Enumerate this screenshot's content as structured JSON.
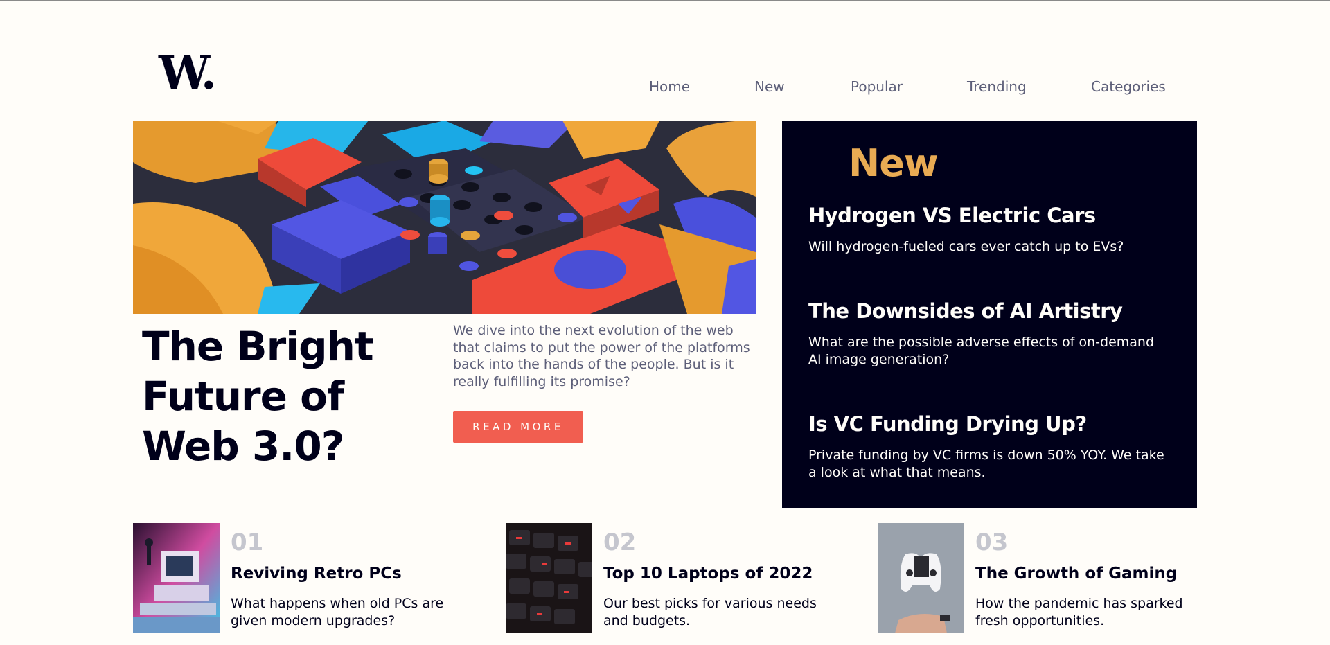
{
  "brand": {
    "logo_text": "W."
  },
  "nav": {
    "items": [
      {
        "label": "Home"
      },
      {
        "label": "New"
      },
      {
        "label": "Popular"
      },
      {
        "label": "Trending"
      },
      {
        "label": "Categories"
      }
    ]
  },
  "hero": {
    "title": "The Bright Future of Web 3.0?",
    "description": "We dive into the next evolution of the web that claims to put the power of the platforms back into the hands of the people. But is it really fulfilling its promise?",
    "button_label": "READ MORE"
  },
  "new_section": {
    "heading": "New",
    "items": [
      {
        "title": "Hydrogen VS Electric Cars",
        "description": "Will hydrogen-fueled cars ever catch up to EVs?"
      },
      {
        "title": "The Downsides of AI Artistry",
        "description": "What are the possible adverse effects of on-demand AI image generation?"
      },
      {
        "title": "Is VC Funding Drying Up?",
        "description": "Private funding by VC firms is down 50% YOY. We take a look at what that means."
      }
    ]
  },
  "cards": [
    {
      "number": "01",
      "title": "Reviving Retro PCs",
      "description": "What happens when old PCs are given modern upgrades?"
    },
    {
      "number": "02",
      "title": "Top 10 Laptops of 2022",
      "description": "Our best picks for various needs and budgets."
    },
    {
      "number": "03",
      "title": "The Growth of Gaming",
      "description": "How the pandemic has sparked fresh opportunities."
    }
  ],
  "colors": {
    "background": "#fffdf9",
    "dark": "#00001a",
    "accent_orange": "#e9ab53",
    "accent_red": "#f15e50",
    "muted": "#5d5f79",
    "number_gray": "#c5c6ce"
  }
}
